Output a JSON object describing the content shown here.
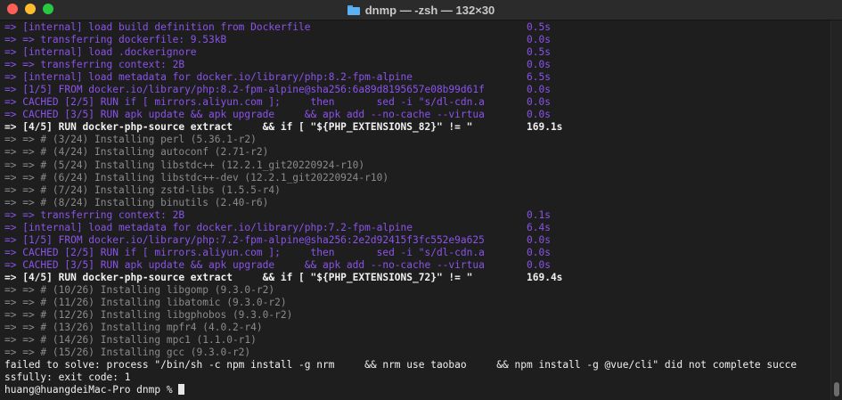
{
  "window": {
    "title": "dnmp — -zsh — 132×30"
  },
  "lines": [
    {
      "text": "=> [internal] load build definition from Dockerfile",
      "time": "0.5s",
      "style": "purple"
    },
    {
      "text": "=> => transferring dockerfile: 9.53kB",
      "time": "0.0s",
      "style": "purple"
    },
    {
      "text": "=> [internal] load .dockerignore",
      "time": "0.5s",
      "style": "purple"
    },
    {
      "text": "=> => transferring context: 2B",
      "time": "0.0s",
      "style": "purple"
    },
    {
      "text": "=> [internal] load metadata for docker.io/library/php:8.2-fpm-alpine",
      "time": "6.5s",
      "style": "purple"
    },
    {
      "text": "=> [1/5] FROM docker.io/library/php:8.2-fpm-alpine@sha256:6a89d8195657e08b99d61f",
      "time": "0.0s",
      "style": "purple"
    },
    {
      "text": "=> CACHED [2/5] RUN if [ mirrors.aliyun.com ];     then       sed -i \"s/dl-cdn.a",
      "time": "0.0s",
      "style": "purple"
    },
    {
      "text": "=> CACHED [3/5] RUN apk update && apk upgrade     && apk add --no-cache --virtua",
      "time": "0.0s",
      "style": "purple"
    },
    {
      "text": "=> [4/5] RUN docker-php-source extract     && if [ \"${PHP_EXTENSIONS_82}\" != \"",
      "time": "169.1s",
      "style": "white"
    },
    {
      "text": "=> => # (3/24) Installing perl (5.36.1-r2)",
      "time": "",
      "style": "gray"
    },
    {
      "text": "=> => # (4/24) Installing autoconf (2.71-r2)",
      "time": "",
      "style": "gray"
    },
    {
      "text": "=> => # (5/24) Installing libstdc++ (12.2.1_git20220924-r10)",
      "time": "",
      "style": "gray"
    },
    {
      "text": "=> => # (6/24) Installing libstdc++-dev (12.2.1_git20220924-r10)",
      "time": "",
      "style": "gray"
    },
    {
      "text": "=> => # (7/24) Installing zstd-libs (1.5.5-r4)",
      "time": "",
      "style": "gray"
    },
    {
      "text": "=> => # (8/24) Installing binutils (2.40-r6)",
      "time": "",
      "style": "gray"
    },
    {
      "text": "=> => transferring context: 2B",
      "time": "0.1s",
      "style": "purple"
    },
    {
      "text": "=> [internal] load metadata for docker.io/library/php:7.2-fpm-alpine",
      "time": "6.4s",
      "style": "purple"
    },
    {
      "text": "=> [1/5] FROM docker.io/library/php:7.2-fpm-alpine@sha256:2e2d92415f3fc552e9a625",
      "time": "0.0s",
      "style": "purple"
    },
    {
      "text": "=> CACHED [2/5] RUN if [ mirrors.aliyun.com ];     then       sed -i \"s/dl-cdn.a",
      "time": "0.0s",
      "style": "purple"
    },
    {
      "text": "=> CACHED [3/5] RUN apk update && apk upgrade     && apk add --no-cache --virtua",
      "time": "0.0s",
      "style": "purple"
    },
    {
      "text": "=> [4/5] RUN docker-php-source extract     && if [ \"${PHP_EXTENSIONS_72}\" != \"",
      "time": "169.4s",
      "style": "white"
    },
    {
      "text": "=> => # (10/26) Installing libgomp (9.3.0-r2)",
      "time": "",
      "style": "gray"
    },
    {
      "text": "=> => # (11/26) Installing libatomic (9.3.0-r2)",
      "time": "",
      "style": "gray"
    },
    {
      "text": "=> => # (12/26) Installing libgphobos (9.3.0-r2)",
      "time": "",
      "style": "gray"
    },
    {
      "text": "=> => # (13/26) Installing mpfr4 (4.0.2-r4)",
      "time": "",
      "style": "gray"
    },
    {
      "text": "=> => # (14/26) Installing mpc1 (1.1.0-r1)",
      "time": "",
      "style": "gray"
    },
    {
      "text": "=> => # (15/26) Installing gcc (9.3.0-r2)",
      "time": "",
      "style": "gray"
    },
    {
      "text": "failed to solve: process \"/bin/sh -c npm install -g nrm     && nrm use taobao     && npm install -g @vue/cli\" did not complete succe",
      "time": "",
      "style": "plain"
    },
    {
      "text": "ssfully: exit code: 1",
      "time": "",
      "style": "plain"
    }
  ],
  "prompt": "huang@huangdeiMac-Pro dnmp % ",
  "colors": {
    "purple": "#8a53ea",
    "gray": "#8b8b8b",
    "white": "#f0f0f0",
    "background": "#1e1e1e"
  },
  "icons": {
    "title": "folder-icon"
  }
}
